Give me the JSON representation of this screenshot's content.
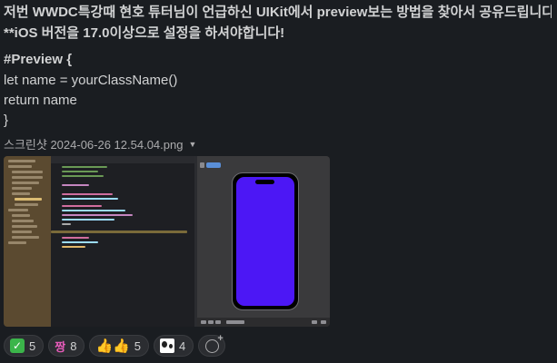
{
  "message": {
    "line1": "저번 WWDC특강때 현호 튜터님이 언급하신 UIKit에서 preview보는 방법을 찾아서 공유드립니다",
    "line2": "**iOS 버전을 17.0이상으로 설정을 하셔야합니다!",
    "code": [
      "#Preview {",
      " let name = yourClassName()",
      " return name",
      "}"
    ]
  },
  "attachment": {
    "filename": "스크린샷 2024-06-26 12.54.04.png",
    "caret_icon": "chevron-down-icon",
    "preview_screen_color": "#4c17f5"
  },
  "reactions": [
    {
      "icon": "white-check-mark",
      "count": "5"
    },
    {
      "icon": "jjang",
      "label": "짱",
      "count": "8"
    },
    {
      "icon": "thumbsup-pair",
      "label": "👍👍",
      "count": "5"
    },
    {
      "icon": "party-cow",
      "count": "4"
    }
  ],
  "add_reaction_icon": "add-reaction-icon"
}
